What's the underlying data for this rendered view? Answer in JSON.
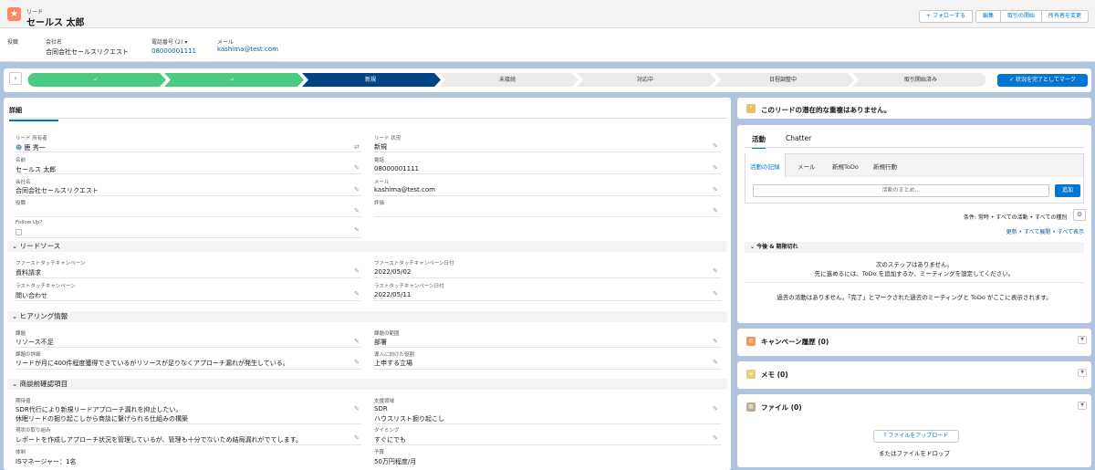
{
  "header": {
    "object_type": "リード",
    "record_name": "セールス 太郎",
    "buttons": {
      "follow": "+ フォローする",
      "edit": "編集",
      "start_deal": "取引の開始",
      "change_owner": "所有者を変更"
    },
    "fields": [
      {
        "label": "役職",
        "value": ""
      },
      {
        "label": "会社名",
        "value": "合同会社セールスリクエスト"
      },
      {
        "label": "電話番号 (2) ▾",
        "value": "08000001111"
      },
      {
        "label": "メール",
        "value": "kashima@test.com"
      }
    ]
  },
  "path": {
    "stages": [
      "✓",
      "✓",
      "新規",
      "未接続",
      "対応中",
      "日程調整中",
      "取引開始済み"
    ],
    "complete_button": "✓ 状況を完了としてマーク",
    "colors": {
      "complete": "#4bca81",
      "current": "#014486",
      "incomplete": "#ecebea"
    }
  },
  "detail": {
    "tab": "詳細",
    "fields": {
      "owner_label": "リード 所有者",
      "owner_value": "鹿 秀一",
      "status_label": "リード 状況",
      "status_value": "新規",
      "name_label": "名前",
      "name_value": "セールス 太郎",
      "phone_label": "電話",
      "phone_value": "08000001111",
      "company_label": "会社名",
      "company_value": "合同会社セールスリクエスト",
      "email_label": "メール",
      "email_value": "kashima@test.com",
      "title_label": "役職",
      "title_value": "",
      "rating_label": "評価",
      "rating_value": "",
      "followup_label": "Follow Up?"
    },
    "sections": {
      "lead_source": "リードソース",
      "hearing": "ヒアリング情報",
      "pre_meeting": "商談前確認項目"
    },
    "lead_source": {
      "ftc_label": "ファーストタッチキャンペーン",
      "ftc_value": "資料請求",
      "ftc_date_label": "ファーストタッチキャンペーン日付",
      "ftc_date_value": "2022/05/02",
      "ltc_label": "ラストタッチキャンペーン",
      "ltc_value": "問い合わせ",
      "ltc_date_label": "ラストタッチキャンペーン日付",
      "ltc_date_value": "2022/05/11"
    },
    "hearing": {
      "issue_label": "課題",
      "issue_value": "リソース不足",
      "scope_label": "課題の範囲",
      "scope_value": "部署",
      "detail_label": "課題の詳細",
      "detail_value": "リードが月に400件程度獲得できているがリソースが足りなくアプローチ漏れが発生している。",
      "role_label": "導入に向けた役割",
      "role_value": "上申する立場"
    },
    "pre_meeting": {
      "expect_label": "期待値",
      "expect_value1": "SDR代行により新規リードアプローチ漏れを抑止したい。",
      "expect_value2": "休眠リードの掘り起こしから商談に繋げられる仕組みの構築",
      "support_label": "支援領域",
      "support_value1": "SDR",
      "support_value2": "ハウスリスト掘り起こし",
      "current_label": "現状の取り組み",
      "current_value": "レポートを作成しアプローチ状況を管理しているが、管理も十分でないため結局漏れがでてします。",
      "timing_label": "タイミング",
      "timing_value": "すぐにでも",
      "system_label": "体制",
      "system_value": "ISマネージャー：1名",
      "budget_label": "予算",
      "budget_value": "50万円程度/月"
    }
  },
  "duplicates": {
    "message": "このリードの潜在的な重複はありません。"
  },
  "activity": {
    "tabs": [
      "活動",
      "Chatter"
    ],
    "subtabs": [
      "活動の記録",
      "メール",
      "新規ToDo",
      "新規行動"
    ],
    "summary_placeholder": "活動のまとめ...",
    "add_button": "追加",
    "filter": "条件: 常時 • すべての活動 • すべての種別",
    "links": "更新 • すべて展開 • すべて表示",
    "upcoming": "今後 & 期限切れ",
    "next_steps_1": "次のステップはありません。",
    "next_steps_2": "先に進めるには、ToDo を追加するか、ミーティングを設定してください。",
    "past": "過去の活動はありません。「完了」とマークされた過去のミーティングと ToDo がここに表示されます。"
  },
  "related": {
    "campaign": "キャンペーン履歴 (0)",
    "notes": "メモ (0)",
    "files": "ファイル (0)",
    "upload_button": "⤒ ファイルをアップロード",
    "drop_text": "またはファイルをドロップ"
  }
}
